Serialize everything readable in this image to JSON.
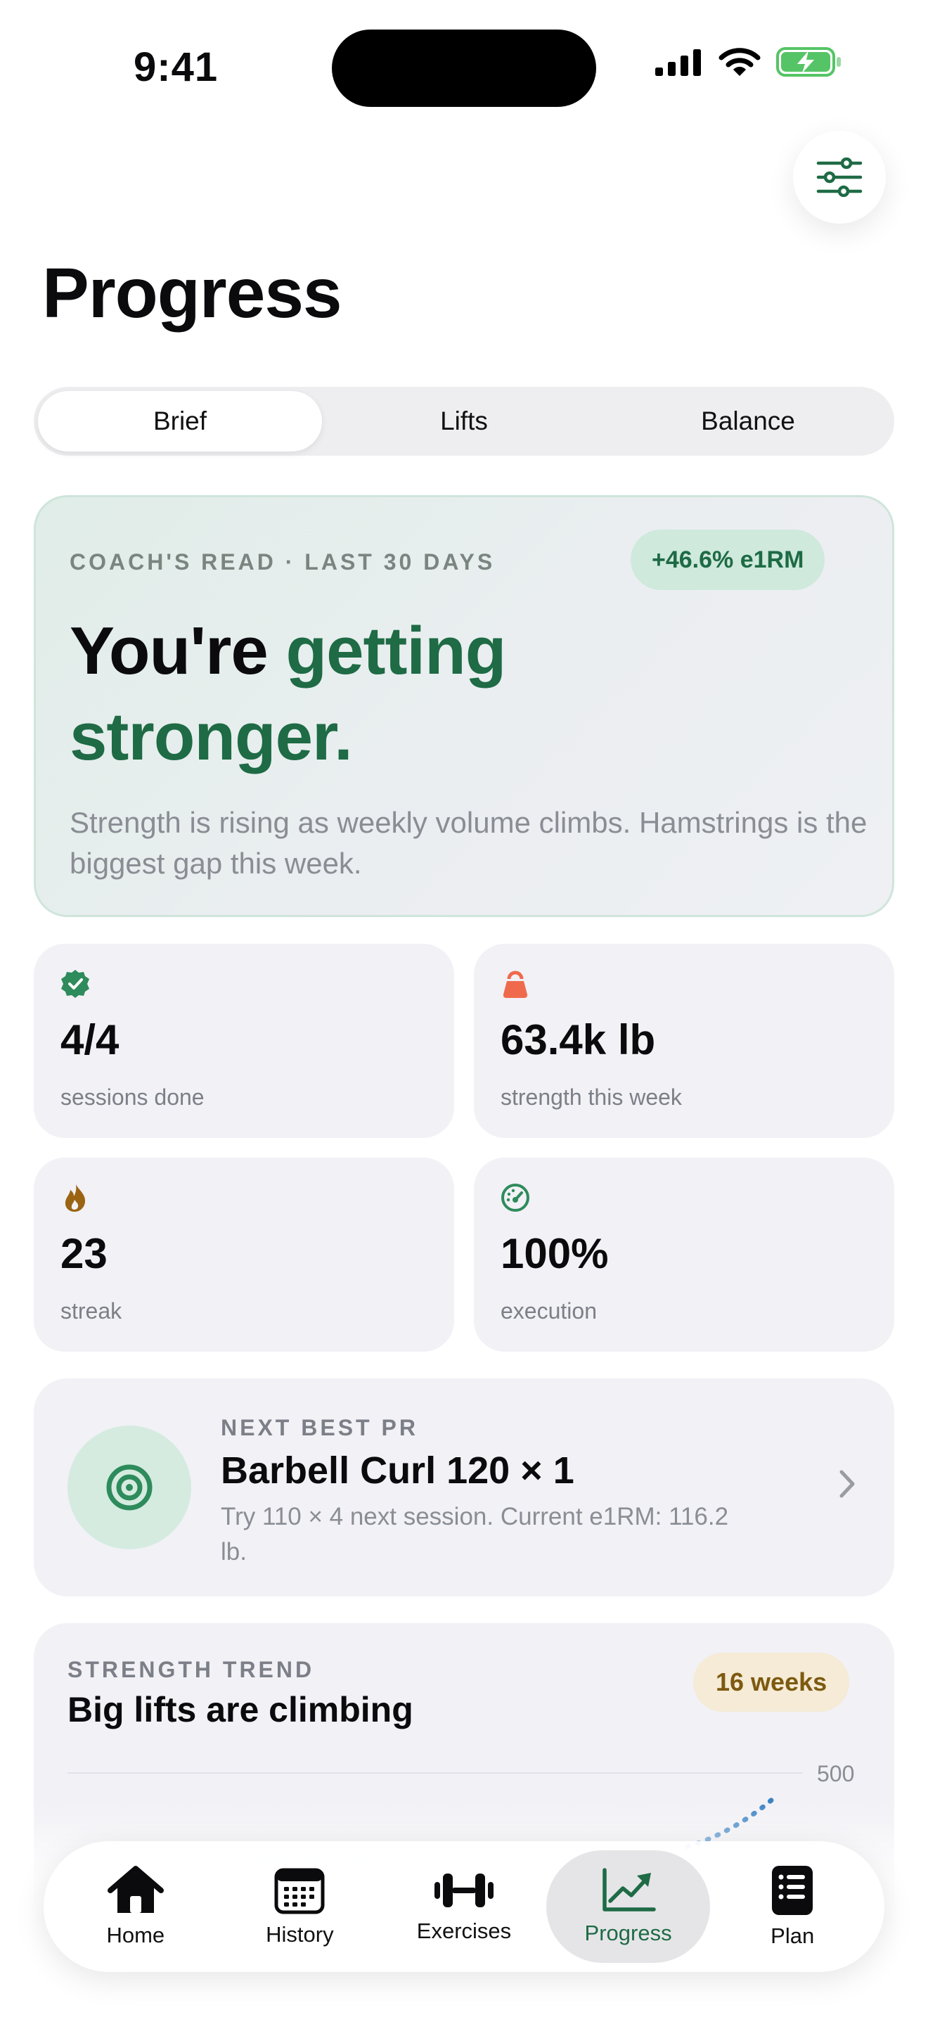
{
  "status_bar": {
    "time": "9:41"
  },
  "header": {
    "title": "Progress"
  },
  "segments": [
    {
      "label": "Brief",
      "active": true
    },
    {
      "label": "Lifts",
      "active": false
    },
    {
      "label": "Balance",
      "active": false
    }
  ],
  "coach": {
    "label": "COACH'S READ · LAST 30 DAYS",
    "badge": "+46.6% e1RM",
    "headline_plain": "You're",
    "headline_accent": "getting stronger.",
    "body": "Strength is rising as weekly volume climbs. Hamstrings is the biggest gap this week."
  },
  "stats": [
    {
      "value": "4/4",
      "label": "sessions done",
      "icon": "check-badge-icon",
      "color": "#2e8b5b"
    },
    {
      "value": "63.4k lb",
      "label": "strength this week",
      "icon": "kettlebell-icon",
      "color": "#ef6a4c"
    },
    {
      "value": "23",
      "label": "streak",
      "icon": "flame-icon",
      "color": "#9a6412"
    },
    {
      "value": "100%",
      "label": "execution",
      "icon": "gauge-icon",
      "color": "#2e8b5b"
    }
  ],
  "next_pr": {
    "label": "NEXT BEST PR",
    "title": "Barbell Curl 120 × 1",
    "body": "Try 110 × 4 next session. Current e1RM: 116.2 lb.",
    "icon": "target-icon"
  },
  "trend": {
    "label": "STRENGTH TREND",
    "title": "Big lifts are climbing",
    "badge": "16 weeks",
    "tick_top": "500"
  },
  "tabs": [
    {
      "label": "Home",
      "icon": "house-icon",
      "active": false
    },
    {
      "label": "History",
      "icon": "calendar-icon",
      "active": false
    },
    {
      "label": "Exercises",
      "icon": "dumbbell-icon",
      "active": false
    },
    {
      "label": "Progress",
      "icon": "chart-up-icon",
      "active": true
    },
    {
      "label": "Plan",
      "icon": "list-icon",
      "active": false
    }
  ],
  "colors": {
    "accent": "#1e6b45",
    "card": "#f1f1f6"
  }
}
